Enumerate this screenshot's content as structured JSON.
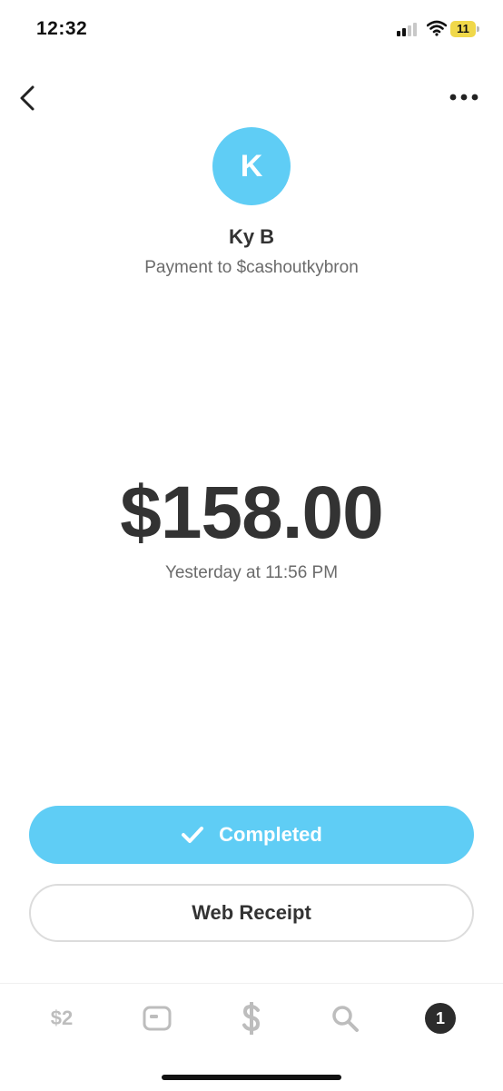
{
  "status_bar": {
    "time": "12:32",
    "battery_level": "11",
    "battery_color": "#f0d84a",
    "signal_bars_active": 2,
    "signal_bars_total": 4
  },
  "nav": {
    "back_icon": "chevron-left-icon",
    "more_icon": "more-horizontal-icon"
  },
  "recipient": {
    "initial": "K",
    "name": "Ky B",
    "subtitle": "Payment to $cashoutkybron",
    "avatar_color": "#5fcdf5"
  },
  "transaction": {
    "amount": "$158.00",
    "timestamp": "Yesterday at 11:56 PM"
  },
  "actions": {
    "status_label": "Completed",
    "receipt_label": "Web Receipt",
    "status_color": "#5fcdf5"
  },
  "tab_bar": {
    "balance_label": "$2",
    "card_icon": "card-icon",
    "pay_icon": "dollar-icon",
    "search_icon": "search-icon",
    "activity_count": "1"
  }
}
